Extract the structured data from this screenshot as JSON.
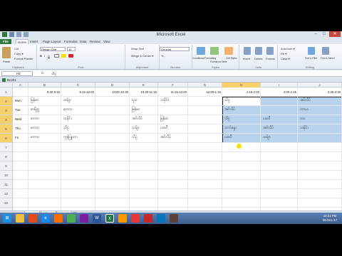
{
  "window": {
    "title": "Microsoft Excel",
    "minimize": "–",
    "maximize": "□",
    "close": "✕"
  },
  "ribbon": {
    "tabs": [
      "File",
      "Home",
      "Insert",
      "Page Layout",
      "Formulas",
      "Data",
      "Review",
      "View"
    ],
    "clipboard": {
      "label": "Clipboard",
      "cut": "Cut",
      "copy": "Copy ▾",
      "format_painter": "Format Painter",
      "paste": "Paste"
    },
    "font": {
      "label": "Font",
      "name": "Design One",
      "size": "14"
    },
    "alignment": {
      "label": "Alignment",
      "wrap": "Wrap Text",
      "merge": "Merge & Center ▾"
    },
    "number": {
      "label": "Number",
      "format": "General",
      "pct": "% ,"
    },
    "styles": {
      "label": "Styles",
      "conditional": "Conditional Formatting",
      "format_table": "Format as Table",
      "cell_styles": "Cell Styles"
    },
    "cells": {
      "label": "Cells",
      "insert": "Insert",
      "delete": "Delete",
      "format": "Format"
    },
    "editing": {
      "label": "Editing",
      "autosum": "AutoSum ▾",
      "fill": "Fill ▾",
      "clear": "Clear ▾",
      "sort": "Sort & Filter",
      "find": "Find & Select"
    }
  },
  "formula_bar": {
    "name_box": "H2",
    "fx": "fx",
    "value": "သိပ္ပံ"
  },
  "workbook": {
    "title": "Book1"
  },
  "columns": [
    "A",
    "B",
    "C",
    "D",
    "E",
    "F",
    "G",
    "H",
    "I",
    "J"
  ],
  "rows": [
    "1",
    "2",
    "3",
    "4",
    "5",
    "6",
    "7",
    "8",
    "9",
    "10",
    "11",
    "12",
    "13",
    "14"
  ],
  "times": [
    "8:30-9:15",
    "9:15-10:00",
    "10:00-10:30",
    "10:30-11:15",
    "11:15-12:00",
    "12:00-1:15",
    "1:15-2:00",
    "2:00-2:45",
    "2:45-3:30"
  ],
  "schedule": [
    {
      "day": "Mon",
      "cells": [
        "မြန်မာ",
        "သင်္ချာ",
        "",
        "ရသ",
        "သမိုင်း",
        "",
        "သိပ္ပံ",
        "",
        "အင်္ဂလိပ်"
      ]
    },
    {
      "day": "Tue",
      "cells": [
        "စာရိတ္တ",
        "ဘောဂ",
        "",
        "မြန်မာ",
        "",
        "",
        "အင်္ဂလိပ်",
        "",
        "ကာယ"
      ]
    },
    {
      "day": "Wed",
      "cells": [
        "ဘောဂ",
        "သမိုင်း",
        "",
        "အင်္ဂလိပ်",
        "မြန်မာ",
        "",
        "သိပ္ပံ",
        "ပထဝီ",
        "ဘဝ"
      ]
    },
    {
      "day": "Thu",
      "cells": [
        "ဘောဂ",
        "သိပ္ပံ",
        "",
        "သင်္ချာ",
        "ပထဝီ",
        "",
        "သက်မွေး",
        "အင်္ဂလိပ်",
        "သမိုင်း"
      ]
    },
    {
      "day": "Fri",
      "cells": [
        "ဘောဂ",
        "ကွန်ပြူတာ",
        "",
        "သိပ္ပံ",
        "အင်္ဂလိပ်",
        "",
        "ပထဝီ",
        "သင်္ချာ",
        ""
      ]
    }
  ],
  "sheets": [
    "Sheet1",
    "Sheet2",
    "Sheet3"
  ],
  "status": {
    "ready": "Ready",
    "zoom": "100%"
  },
  "taskbar": {
    "clock_time": "10:21 PM",
    "clock_date": "06-Dec-17"
  },
  "colors": {
    "selection": "#b9d3ee",
    "excel_green": "#2c7a3d",
    "header_highlight": "#f7cf6b"
  }
}
